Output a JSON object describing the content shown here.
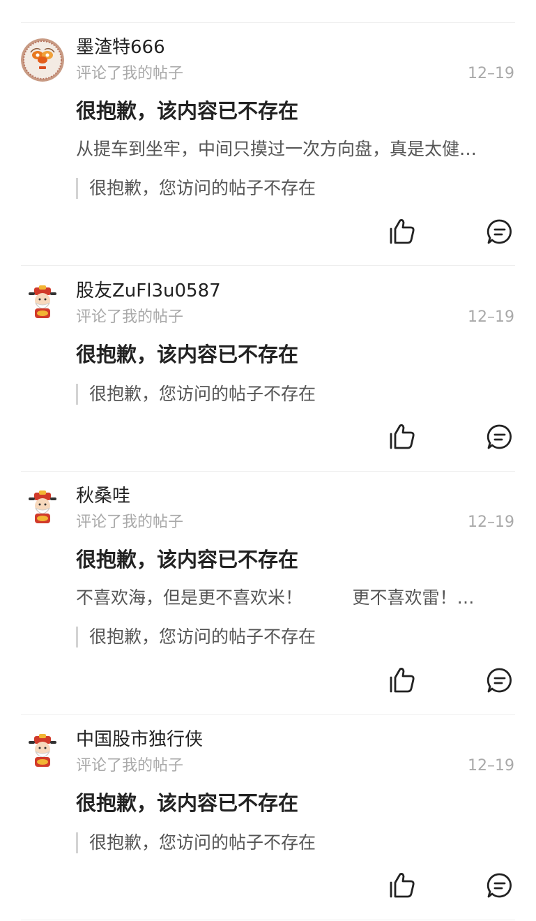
{
  "notifications": [
    {
      "username": "墨渣特666",
      "action": "评论了我的帖子",
      "date": "12–19",
      "title": "很抱歉，该内容已不存在",
      "excerpt": "从提车到坐牢，中间只摸过一次方向盘，真是太健…",
      "quote": "很抱歉，您访问的帖子不存在",
      "avatar_icon": "orange-flower-avatar-icon"
    },
    {
      "username": "股友ZuFl3u0587",
      "action": "评论了我的帖子",
      "date": "12–19",
      "title": "很抱歉，该内容已不存在",
      "excerpt": "",
      "quote": "很抱歉，您访问的帖子不存在",
      "avatar_icon": "fortune-god-avatar-icon"
    },
    {
      "username": "秋桑哇",
      "action": "评论了我的帖子",
      "date": "12–19",
      "title": "很抱歉，该内容已不存在",
      "excerpt": "不喜欢海，但是更不喜欢米！         更不喜欢雷！…",
      "quote": "很抱歉，您访问的帖子不存在",
      "avatar_icon": "fortune-god-avatar-icon"
    },
    {
      "username": "中国股市独行侠",
      "action": "评论了我的帖子",
      "date": "12–19",
      "title": "很抱歉，该内容已不存在",
      "excerpt": "",
      "quote": "很抱歉，您访问的帖子不存在",
      "avatar_icon": "fortune-god-avatar-icon"
    }
  ],
  "icons": {
    "like": "thumbs-up-icon",
    "reply": "comment-bubble-icon"
  },
  "colors": {
    "text_primary": "#222222",
    "text_secondary": "#a9a9a9",
    "text_body": "#555555",
    "divider": "#eeeeee",
    "quote_bar": "#d3d3d3"
  }
}
